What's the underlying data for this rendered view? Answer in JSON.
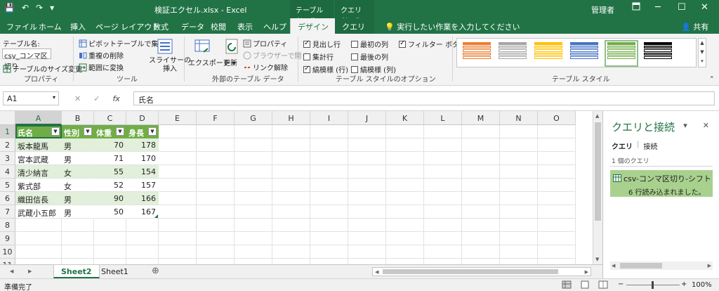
{
  "titlebar": {
    "qat_save": "💾",
    "qat_undo": "↶",
    "qat_redo": "↷",
    "qat_more": "▾",
    "doc_title": "検証エクセル.xlsx  -  Excel",
    "ctx_table": "テーブル ツール",
    "ctx_query": "クエリ ツール",
    "user": "管理者",
    "ribbon_display_icon": "ribbon-display-icon",
    "minimize": "─",
    "restore": "☐",
    "close": "✕"
  },
  "tabs": {
    "items": [
      "ファイル",
      "ホーム",
      "挿入",
      "ページ レイアウト",
      "数式",
      "データ",
      "校閲",
      "表示",
      "ヘルプ"
    ],
    "design": "デザイン",
    "query": "クエリ",
    "tellme": "実行したい作業を入力してください",
    "share": "共有"
  },
  "ribbon": {
    "properties": {
      "table_name_label": "テーブル名:",
      "table_name_value": "csv_コンマ区切り",
      "resize": "テーブルのサイズ変更",
      "group": "プロパティ"
    },
    "tools": {
      "pivot": "ピボットテーブルで集計",
      "remove_dup": "重複の削除",
      "convert": "範囲に変換",
      "slicer": "スライサーの",
      "slicer2": "挿入",
      "group": "ツール"
    },
    "external": {
      "export": "エクスポート",
      "refresh": "更新",
      "properties": "プロパティ",
      "browser": "ブラウザーで開く",
      "unlink": "リンク解除",
      "group": "外部のテーブル データ"
    },
    "style_options": {
      "header_row": "見出し行",
      "total_row": "集計行",
      "banded_rows": "縞模様 (行)",
      "first_col": "最初の列",
      "last_col": "最後の列",
      "banded_cols": "縞模様 (列)",
      "filter_btn": "フィルター ボタン",
      "group": "テーブル スタイルのオプション"
    },
    "table_styles": {
      "group": "テーブル スタイル",
      "swatch_colors": [
        "#ed7d31",
        "#a5a5a5",
        "#ffc000",
        "#4472c4",
        "#70ad47",
        "#000000"
      ]
    }
  },
  "formula_bar": {
    "cell_ref": "A1",
    "cancel": "✕",
    "enter": "✓",
    "fx": "fx",
    "value": "氏名"
  },
  "grid": {
    "columns": [
      "A",
      "B",
      "C",
      "D",
      "E",
      "F",
      "G",
      "H",
      "I",
      "J",
      "K",
      "L",
      "M",
      "N",
      "O"
    ],
    "rows": [
      "1",
      "2",
      "3",
      "4",
      "5",
      "6",
      "7",
      "8",
      "9",
      "10",
      "11"
    ],
    "headers": [
      "氏名",
      "性別",
      "体重",
      "身長"
    ],
    "data": [
      [
        "坂本龍馬",
        "男",
        "70",
        "178"
      ],
      [
        "宮本武蔵",
        "男",
        "71",
        "170"
      ],
      [
        "清少納言",
        "女",
        "55",
        "154"
      ],
      [
        "紫式部",
        "女",
        "52",
        "157"
      ],
      [
        "織田信長",
        "男",
        "90",
        "166"
      ],
      [
        "武蔵小五郎",
        "男",
        "50",
        "167"
      ]
    ],
    "filter_glyph": "▼"
  },
  "sheets": {
    "tabs": [
      "Sheet2",
      "Sheet1"
    ],
    "active": "Sheet2",
    "add": "⊕"
  },
  "status": {
    "ready": "準備完了",
    "zoom": "100%",
    "minus": "−",
    "plus": "+"
  },
  "queries_pane": {
    "title": "クエリと接続",
    "dropdown": "▾",
    "close": "✕",
    "tab_queries": "クエリ",
    "tab_sep": "|",
    "tab_connections": "接続",
    "count": "1 個のクエリ",
    "item_name": "csv-コンマ区切り-シフト",
    "item_status": "6 行読み込まれました。"
  },
  "colors": {
    "accent": "#217346",
    "table_header": "#70ad47",
    "band": "#e2efda",
    "query_item": "#a9d18e"
  }
}
